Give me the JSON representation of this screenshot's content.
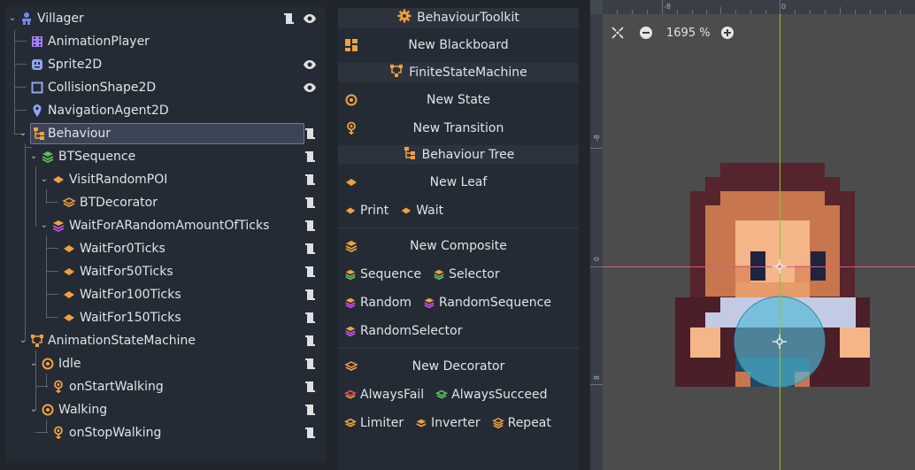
{
  "scene_tree": {
    "nodes": [
      {
        "label": "Villager",
        "icon": "villager-node-icon",
        "color": "#6d8fe0"
      },
      {
        "label": "AnimationPlayer",
        "icon": "animation-player-icon",
        "color": "#a37ff0"
      },
      {
        "label": "Sprite2D",
        "icon": "sprite2d-icon",
        "color": "#8da5f3"
      },
      {
        "label": "CollisionShape2D",
        "icon": "collision-shape-icon",
        "color": "#8da5f3"
      },
      {
        "label": "NavigationAgent2D",
        "icon": "navigation-agent-icon",
        "color": "#8da5f3"
      },
      {
        "label": "Behaviour",
        "icon": "behaviour-tree-icon",
        "color": "#f0a040"
      },
      {
        "label": "BTSequence",
        "icon": "sequence-icon",
        "color": "#5fbf5f"
      },
      {
        "label": "VisitRandomPOI",
        "icon": "leaf-icon",
        "color": "#f0a040"
      },
      {
        "label": "BTDecorator",
        "icon": "decorator-icon",
        "color": "#f0a040"
      },
      {
        "label": "WaitForARandomAmountOfTicks",
        "icon": "random-composite-icon",
        "color": "#c050e0"
      },
      {
        "label": "WaitFor0Ticks",
        "icon": "leaf-icon",
        "color": "#f0a040"
      },
      {
        "label": "WaitFor50Ticks",
        "icon": "leaf-icon",
        "color": "#f0a040"
      },
      {
        "label": "WaitFor100Ticks",
        "icon": "leaf-icon",
        "color": "#f0a040"
      },
      {
        "label": "WaitFor150Ticks",
        "icon": "leaf-icon",
        "color": "#f0a040"
      },
      {
        "label": "AnimationStateMachine",
        "icon": "state-machine-icon",
        "color": "#f0a040"
      },
      {
        "label": "Idle",
        "icon": "state-icon",
        "color": "#f0a040"
      },
      {
        "label": "onStartWalking",
        "icon": "transition-icon",
        "color": "#f0a040"
      },
      {
        "label": "Walking",
        "icon": "state-icon",
        "color": "#f0a040"
      },
      {
        "label": "onStopWalking",
        "icon": "transition-icon",
        "color": "#f0a040"
      }
    ]
  },
  "toolkit": {
    "title": "BehaviourToolkit",
    "new_blackboard": "New Blackboard",
    "fsm_header": "FiniteStateMachine",
    "new_state": "New State",
    "new_transition": "New Transition",
    "bt_header": "Behaviour Tree",
    "new_leaf": "New Leaf",
    "leaf_chips": [
      "Print",
      "Wait"
    ],
    "new_composite": "New Composite",
    "composite_chips_row1": [
      "Sequence",
      "Selector"
    ],
    "composite_chips_row2": [
      "Random",
      "RandomSequence"
    ],
    "composite_chips_row3": [
      "RandomSelector"
    ],
    "new_decorator": "New Decorator",
    "decorator_chips_row1": [
      "AlwaysFail",
      "AlwaysSucceed"
    ],
    "decorator_chips_row2": [
      "Limiter",
      "Inverter",
      "Repeat"
    ]
  },
  "viewport": {
    "zoom": "1695 %",
    "ruler_top_labels": [
      "-8",
      "0"
    ],
    "ruler_left_labels": [
      "-8",
      "0",
      "8"
    ]
  },
  "colors": {
    "accent_orange": "#f0a040",
    "sequence_green": "#5fbf5f",
    "random_magenta": "#c050e0",
    "fail_red": "#e05050"
  }
}
